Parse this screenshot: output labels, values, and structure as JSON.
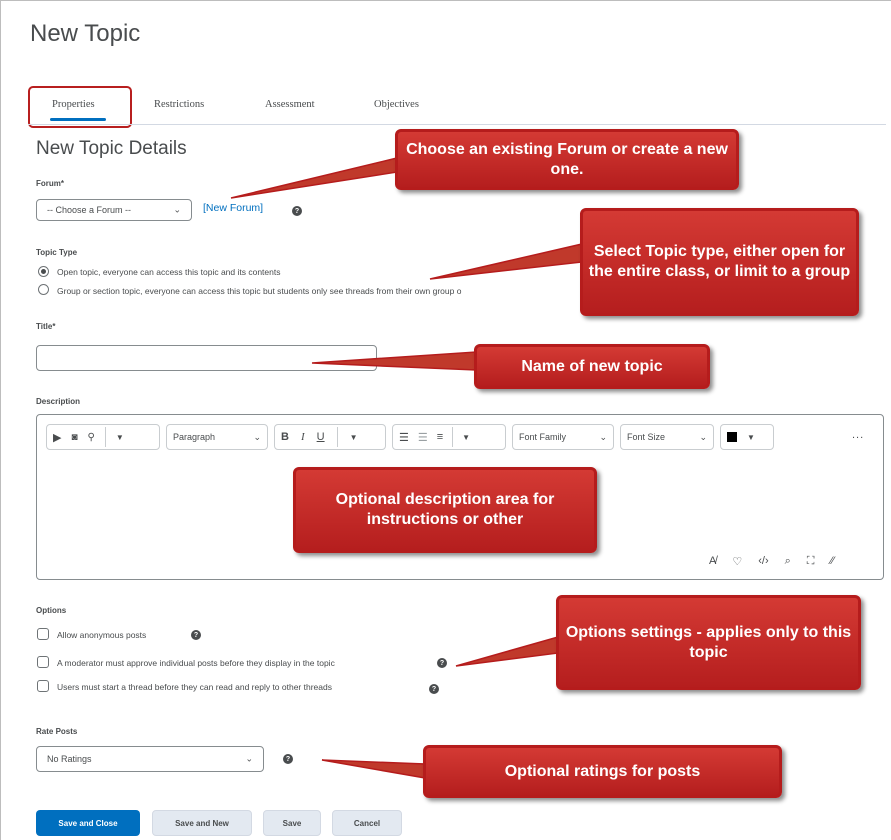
{
  "page": {
    "title": "New Topic"
  },
  "tabs": [
    {
      "label": "Properties",
      "active": true
    },
    {
      "label": "Restrictions"
    },
    {
      "label": "Assessment"
    },
    {
      "label": "Objectives"
    }
  ],
  "details": {
    "title": "New Topic Details"
  },
  "forum": {
    "label": "Forum",
    "required_mark": "*",
    "select_value": "-- Choose a Forum --",
    "new_forum_link": "[New Forum]"
  },
  "topic_type": {
    "label": "Topic Type",
    "options": [
      {
        "label": "Open topic, everyone can access this topic and its contents",
        "checked": true
      },
      {
        "label": "Group or section topic, everyone can access this topic but students only see threads from their own group o",
        "checked": false
      }
    ]
  },
  "title_field": {
    "label": "Title",
    "required_mark": "*",
    "value": ""
  },
  "description": {
    "label": "Description",
    "paragraph_label": "Paragraph",
    "bold": "B",
    "italic": "I",
    "underline": "U",
    "font_family": "Font Family",
    "font_size": "Font Size",
    "more": "..."
  },
  "options": {
    "label": "Options",
    "items": [
      {
        "label": "Allow anonymous posts"
      },
      {
        "label": "A moderator must approve individual posts before they display in the topic"
      },
      {
        "label": "Users must start a thread before they can read and reply to other threads"
      }
    ]
  },
  "rate_posts": {
    "label": "Rate Posts",
    "select_value": "No Ratings"
  },
  "buttons": {
    "save_close": "Save and Close",
    "save_new": "Save and New",
    "save": "Save",
    "cancel": "Cancel"
  },
  "callouts": {
    "forum": "Choose an existing Forum or create a new one.",
    "topic_type": "Select Topic type, either open for the entire class, or limit to a group",
    "title": "Name of new topic",
    "description": "Optional description area for instructions or other",
    "options": "Options settings - applies only to this topic",
    "ratings": "Optional ratings for posts"
  },
  "colors": {
    "accent_blue": "#006fbf",
    "callout_red": "#c0392b",
    "highlight_border": "#b81f1f"
  }
}
